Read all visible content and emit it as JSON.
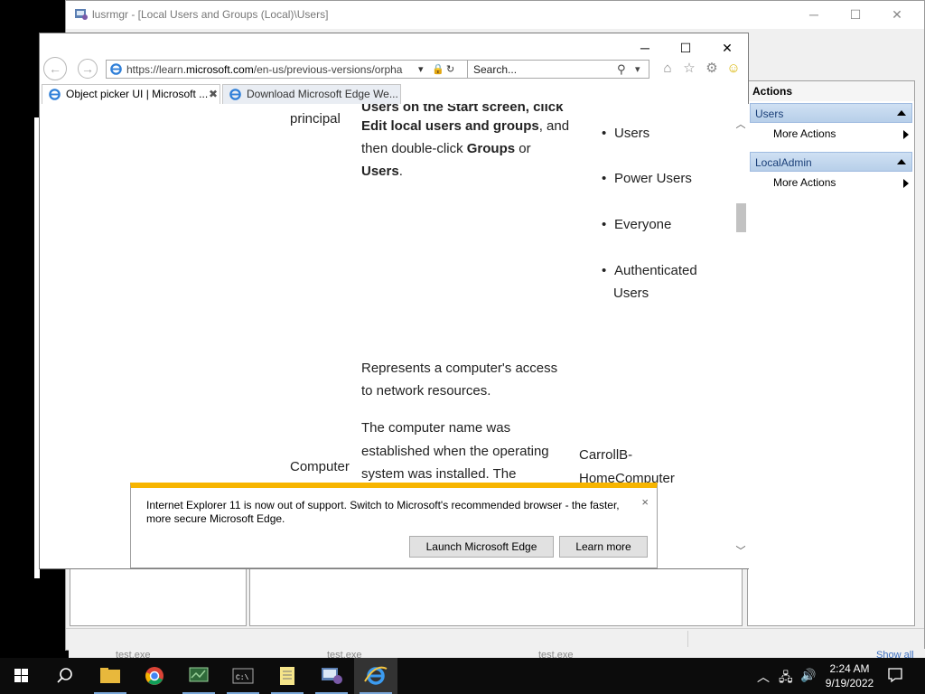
{
  "mmc": {
    "title": "lusrmgr - [Local Users and Groups (Local)\\Users]",
    "minimize": "─",
    "maximize": "☐",
    "close": "✕",
    "actions": {
      "header": "Actions",
      "groups": [
        {
          "label": "Users",
          "items": [
            "More Actions"
          ]
        },
        {
          "label": "LocalAdmin",
          "items": [
            "More Actions"
          ]
        }
      ]
    },
    "status_hint": [
      "test.exe",
      "test.exe",
      "test.exe",
      "Show all"
    ]
  },
  "ie": {
    "minimize": "─",
    "maximize": "☐",
    "close": "✕",
    "back": "←",
    "forward": "→",
    "url_prefix": "https://learn.",
    "url_domain": "microsoft.com",
    "url_suffix": "/en-us/previous-versions/orpha",
    "search_placeholder": "Search...",
    "tabs": [
      {
        "label": "Object picker UI | Microsoft ..."
      },
      {
        "label": "Download Microsoft Edge We..."
      }
    ],
    "content": {
      "row1_col1": "principal",
      "row1_line0": "Users on the Start screen, click",
      "row1_line1_bold": "Edit local users and groups",
      "row1_line1_rest": ", and",
      "row1_line2_pre": "then double-click ",
      "row1_line2_bold": "Groups",
      "row1_line2_post": " or",
      "row1_line3_bold": "Users",
      "row1_line3_post": ".",
      "row1_list": [
        "Users",
        "Power Users",
        "Everyone",
        "Authenticated",
        "Users"
      ],
      "row2_line1": "Represents a computer's access",
      "row2_line2": "to network resources.",
      "row3_line1": "The computer name was",
      "row3_line2": "established when the operating",
      "row3_line3": "system was installed. The",
      "row3_col1": "Computer",
      "row3_col3_line1": "CarrollB-",
      "row3_col3_line2": "HomeComputer"
    },
    "notification": {
      "message": "Internet Explorer 11 is now out of support. Switch to Microsoft's recommended browser - the faster, more secure Microsoft Edge.",
      "launch_button": "Launch Microsoft Edge",
      "learn_button": "Learn more",
      "close": "×"
    }
  },
  "taskbar": {
    "time": "2:24 AM",
    "date": "9/19/2022",
    "tray_icons": [
      "chevron-up-icon",
      "network-icon",
      "volume-icon",
      "notification-icon"
    ]
  },
  "colors": {
    "notify_accent": "#f7b500",
    "actions_group_bg": "#c4d8ef",
    "taskbar_bg": "#0c0c0c"
  }
}
